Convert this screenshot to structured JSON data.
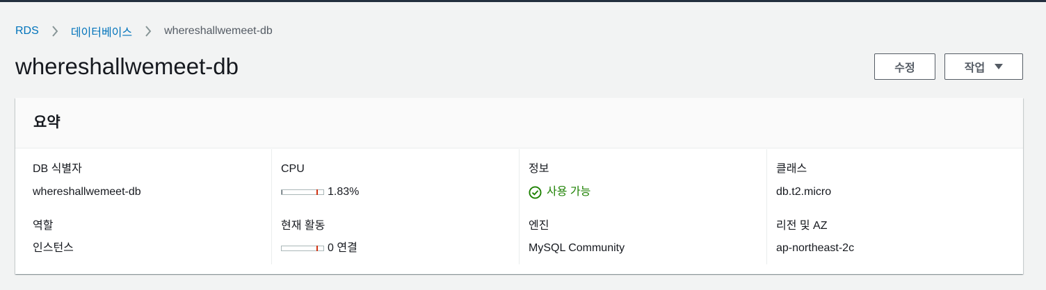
{
  "breadcrumb": {
    "items": [
      {
        "label": "RDS"
      },
      {
        "label": "데이터베이스"
      },
      {
        "label": "whereshallwemeet-db"
      }
    ]
  },
  "page": {
    "title": "whereshallwemeet-db"
  },
  "actions": {
    "modify_label": "수정",
    "actions_label": "작업"
  },
  "summary": {
    "title": "요약",
    "db_identifier": {
      "label": "DB 식별자",
      "value": "whereshallwemeet-db"
    },
    "role": {
      "label": "역할",
      "value": "인스턴스"
    },
    "cpu": {
      "label": "CPU",
      "value": "1.83%",
      "percent": 1.83
    },
    "current_activity": {
      "label": "현재 활동",
      "value": "0 연결",
      "connections": 0
    },
    "info": {
      "label": "정보",
      "value": "사용 가능",
      "status_color": "#1d8102"
    },
    "engine": {
      "label": "엔진",
      "value": "MySQL Community"
    },
    "class": {
      "label": "클래스",
      "value": "db.t2.micro"
    },
    "region_az": {
      "label": "리전 및 AZ",
      "value": "ap-northeast-2c"
    }
  },
  "icons": {
    "breadcrumb_separator": "chevron-right-icon",
    "actions_caret": "caret-down-icon",
    "status": "check-circle-icon"
  },
  "colors": {
    "link": "#0073bb",
    "success": "#1d8102",
    "header_bar": "#232f3e",
    "threshold": "#d13212"
  }
}
